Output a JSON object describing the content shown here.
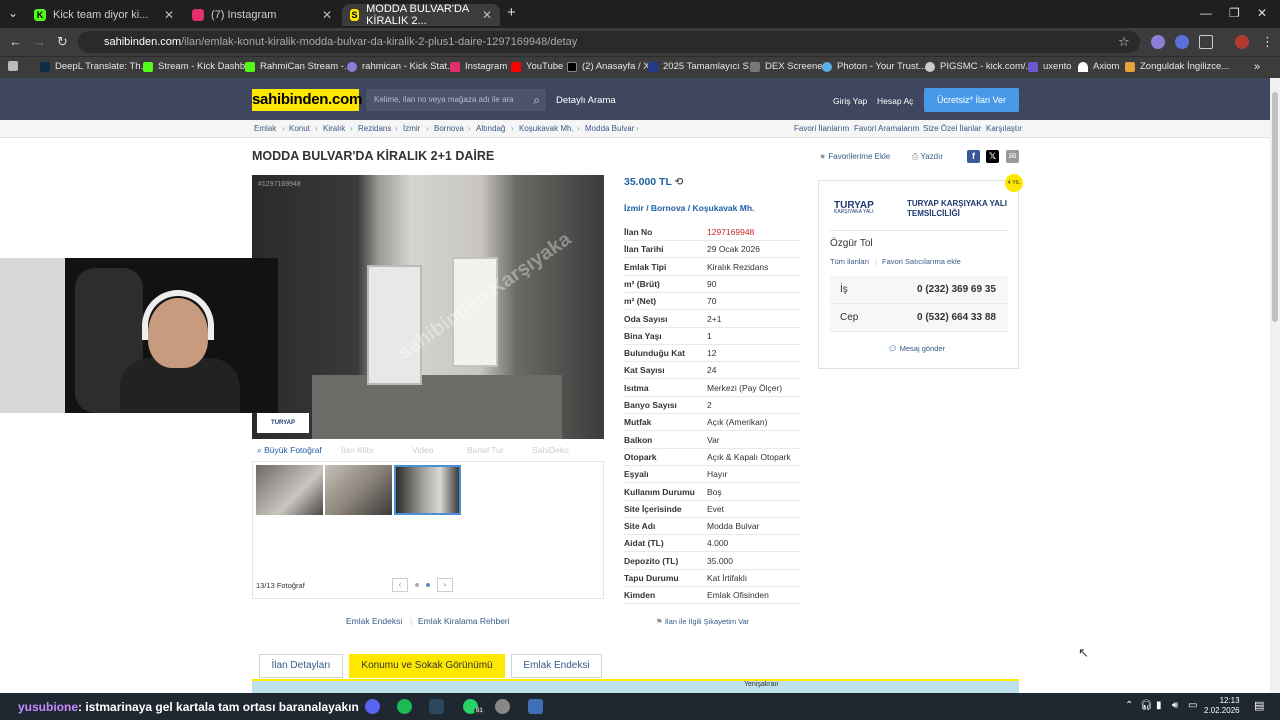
{
  "browser": {
    "tabs": [
      {
        "label": "Kick team diyor ki...",
        "icon_color": "#53fc18"
      },
      {
        "label": "(7) Instagram",
        "icon_color": "#e1306c"
      },
      {
        "label": "MODDA BULVAR'DA KİRALIK 2...",
        "icon_color": "#ffe800"
      }
    ],
    "url_host": "sahibinden.com",
    "url_path": "/ilan/emlak-konut-kiralik-modda-bulvar-da-kiralik-2-plus1-daire-1297169948/detay",
    "bookmarks": [
      "DeepL Translate: Th...",
      "Stream - Kick Dashb...",
      "RahmiCan Stream -...",
      "rahmican - Kick Stat...",
      "Instagram",
      "YouTube",
      "(2) Anasayfa / X",
      "2025 Tamamlayıcı S...",
      "DEX Screener",
      "Photon - Your Trust...",
      "PIGSMC - kick.com/...",
      "uxento",
      "Axiom",
      "Zonguldak İngilizce..."
    ]
  },
  "header": {
    "logo": "sahibinden.com",
    "search_placeholder": "Kelime, ilan no veya mağaza adı ile ara",
    "detailed_search": "Detaylı Arama",
    "login": "Giriş Yap",
    "register": "Hesap Aç",
    "post_ad": "Ücretsiz* İlan Ver"
  },
  "breadcrumbs": [
    "Emlak",
    "Konut",
    "Kiralık",
    "Rezidans",
    "İzmir",
    "Bornova",
    "Altındağ",
    "Koşukavak Mh.",
    "Modda Bulvar"
  ],
  "top_links": [
    "Favori İlanlarım",
    "Favori Aramalarım",
    "Size Özel İlanlar",
    "Karşılaştır"
  ],
  "listing": {
    "title": "MODDA BULVAR'DA KİRALIK 2+1 DAİRE",
    "add_favorite": "Favorilerime Ekle",
    "print": "Yazdır",
    "photo_id": "#1297169948",
    "watermark": "sahibinden Karşıyaka",
    "photo_logo": "TURYAP",
    "photo_tools": [
      "Büyük Fotoğraf",
      "İlan Klibi",
      "Video",
      "Banaf Tur",
      "SahiDeko"
    ],
    "photo_count": "13/13 Fotoğraf",
    "price": "35.000 TL",
    "location": "İzmir  /  Bornova  /  Koşukavak Mh.",
    "details": [
      {
        "k": "İlan No",
        "v": "1297169948"
      },
      {
        "k": "İlan Tarihi",
        "v": "29 Ocak 2026"
      },
      {
        "k": "Emlak Tipi",
        "v": "Kiralık Rezidans"
      },
      {
        "k": "m² (Brüt)",
        "v": "90"
      },
      {
        "k": "m² (Net)",
        "v": "70"
      },
      {
        "k": "Oda Sayısı",
        "v": "2+1"
      },
      {
        "k": "Bina Yaşı",
        "v": "1"
      },
      {
        "k": "Bulunduğu Kat",
        "v": "12"
      },
      {
        "k": "Kat Sayısı",
        "v": "24"
      },
      {
        "k": "Isıtma",
        "v": "Merkezi (Pay Ölçer)"
      },
      {
        "k": "Banyo Sayısı",
        "v": "2"
      },
      {
        "k": "Mutfak",
        "v": "Açık (Amerikan)"
      },
      {
        "k": "Balkon",
        "v": "Var"
      },
      {
        "k": "Otopark",
        "v": "Açık & Kapalı Otopark"
      },
      {
        "k": "Eşyalı",
        "v": "Hayır"
      },
      {
        "k": "Kullanım Durumu",
        "v": "Boş"
      },
      {
        "k": "Site İçerisinde",
        "v": "Evet"
      },
      {
        "k": "Site Adı",
        "v": "Modda Bulvar"
      },
      {
        "k": "Aidat (TL)",
        "v": "4.000"
      },
      {
        "k": "Depozito (TL)",
        "v": "35.000"
      },
      {
        "k": "Tapu Durumu",
        "v": "Kat İrtifaklı"
      },
      {
        "k": "Kimden",
        "v": "Emlak Ofisinden"
      }
    ],
    "complaint": "İlan ile İlgili Şikayetim Var",
    "bottom_links": [
      "Emlak Endeksi",
      "Emlak Kiralama Rehberi"
    ],
    "bottom_tabs": [
      "İlan Detayları",
      "Konumu ve Sokak Görünümü",
      "Emlak Endeksi"
    ],
    "map_label": "Yenişakran"
  },
  "seller": {
    "badge": "4 YIL",
    "agency_logo": "TURYAP",
    "agency_sub": "KARŞIYAKA YALI",
    "agency_name": "TURYAP KARŞIYAKA YALI TEMSİLCİLİĞİ",
    "name": "Özgür Tol",
    "all_ads": "Tüm ilanları",
    "fav_seller": "Favori Satıcılarıma ekle",
    "phones": [
      {
        "label": "İş",
        "number": "0 (232) 369 69 35"
      },
      {
        "label": "Cep",
        "number": "0 (532) 664 33 88"
      }
    ],
    "send_message": "Mesaj gönder"
  },
  "overlay": {
    "chat_user": "yusubione",
    "chat_text": ": istmarinaya gel kartala tam ortası baranalayakın"
  },
  "taskbar": {
    "time": "12:13",
    "date": "2.02.2026",
    "whatsapp_badge": "81"
  }
}
